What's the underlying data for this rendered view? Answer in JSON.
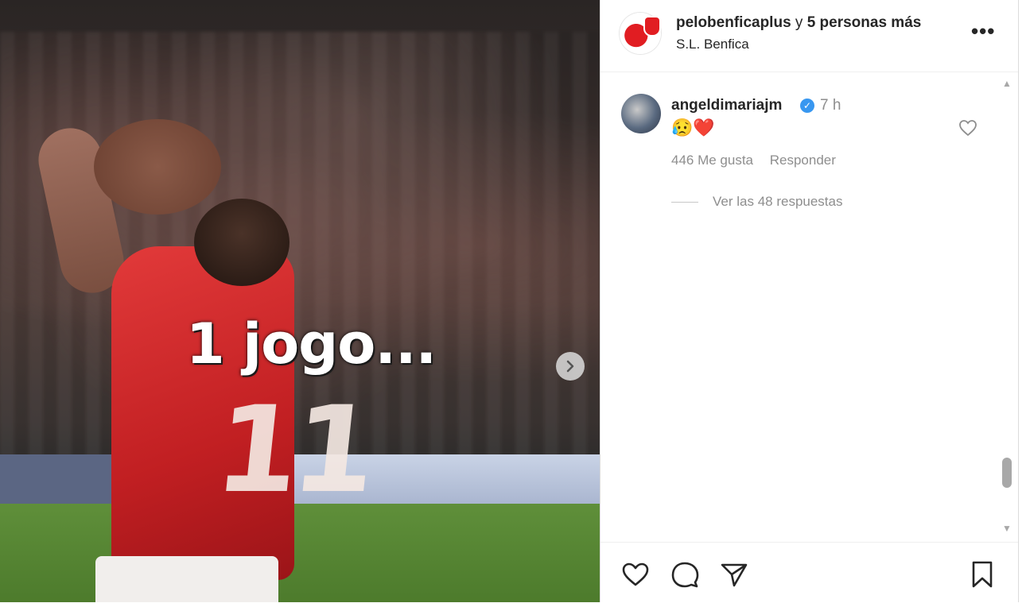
{
  "media": {
    "overlay_text": "1 jogo...",
    "jersey_number": "11",
    "next_icon": "chevron-right-icon"
  },
  "header": {
    "account": "pelobenficaplus",
    "connector": " y ",
    "others": "5 personas más",
    "subtitle": "S.L. Benfica",
    "more_label": "•••"
  },
  "comment": {
    "username": "angeldimariajm",
    "verified": "✓",
    "time": "7 h",
    "text": "😥❤️",
    "likes": "446 Me gusta",
    "reply_label": "Responder",
    "view_replies": "Ver las 48 respuestas"
  },
  "colors": {
    "accent_blue": "#3897f0",
    "benfica_red": "#e11d22",
    "muted_text": "#8e8e8e"
  },
  "actions": {
    "icons": [
      "heart-icon",
      "comment-icon",
      "share-icon",
      "bookmark-icon"
    ]
  }
}
